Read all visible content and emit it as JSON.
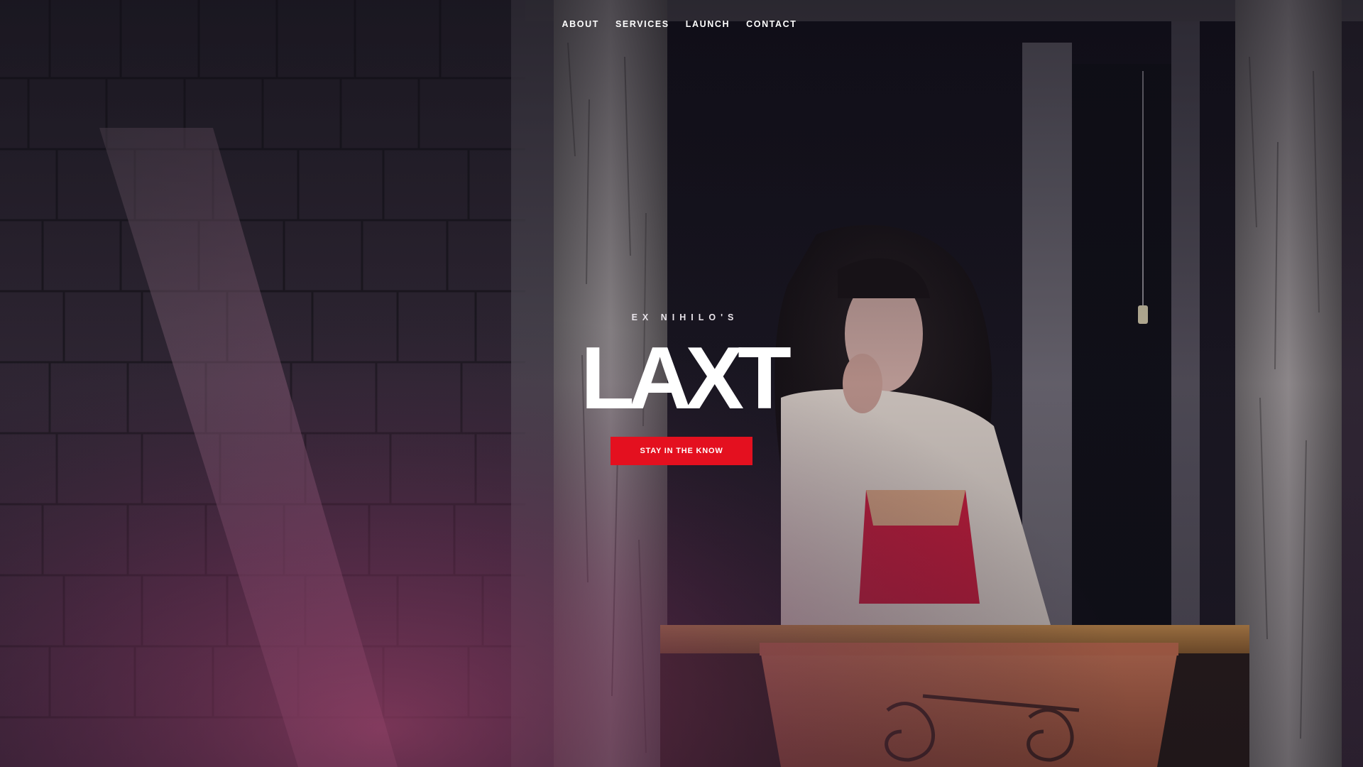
{
  "nav": {
    "items": [
      {
        "label": "ABOUT"
      },
      {
        "label": "SERVICES"
      },
      {
        "label": "LAUNCH"
      },
      {
        "label": "CONTACT"
      }
    ]
  },
  "hero": {
    "eyebrow": "EX NIHILO'S",
    "title": "LAXT",
    "cta_label": "STAY IN THE KNOW"
  },
  "colors": {
    "accent": "#e4101f",
    "overlay_pink": "#c0407a",
    "text": "#ffffff"
  }
}
